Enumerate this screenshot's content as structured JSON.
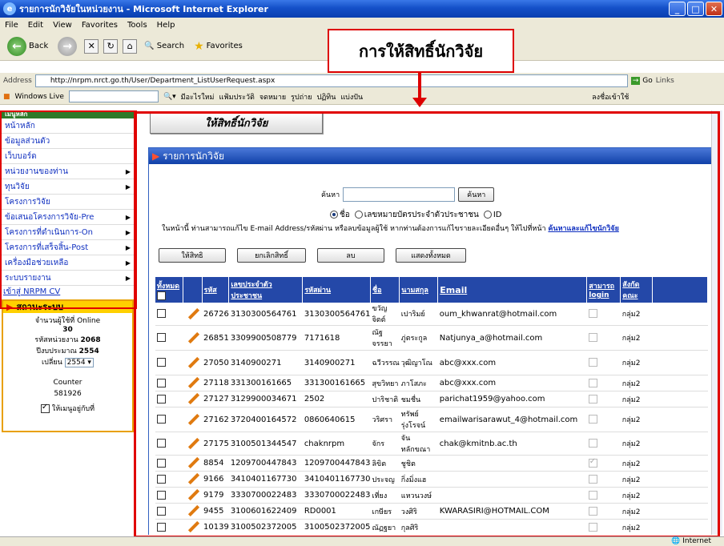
{
  "window": {
    "title": "รายการนักวิจัยในหน่วยงาน - Microsoft Internet Explorer",
    "icon": "ie-icon"
  },
  "menubar": [
    "File",
    "Edit",
    "View",
    "Favorites",
    "Tools",
    "Help"
  ],
  "toolbar": {
    "back": "Back",
    "search": "Search",
    "favorites": "Favorites"
  },
  "address": {
    "label": "Address",
    "url": "http://nrpm.nrct.go.th/User/Department_ListUserRequest.aspx",
    "go": "Go",
    "links": "Links"
  },
  "linkbar": {
    "windows_live": "Windows Live",
    "items": [
      "มีอะไรใหม่",
      "แฟ้มประวัติ",
      "จดหมาย",
      "รูปถ่าย",
      "ปฏิทิน",
      "แบ่งปัน"
    ],
    "signin": "ลงชื่อเข้าใช้"
  },
  "callout": "การให้สิทธิ์นักวิจัย",
  "sidebar": {
    "header": "เมนูหลัก",
    "items": [
      {
        "label": "หน้าหลัก",
        "arrow": false
      },
      {
        "label": "ข้อมูลส่วนตัว",
        "arrow": false
      },
      {
        "label": "เว็บบอร์ด",
        "arrow": false
      },
      {
        "label": "หน่วยงานของท่าน",
        "arrow": true
      },
      {
        "label": "ทุนวิจัย",
        "arrow": true
      },
      {
        "label": "โครงการวิจัย",
        "arrow": false
      },
      {
        "label": "ข้อเสนอโครงการวิจัย-Pre",
        "arrow": true
      },
      {
        "label": "โครงการที่ดำเนินการ-On",
        "arrow": true
      },
      {
        "label": "โครงการที่เสร็จสิ้น-Post",
        "arrow": true
      },
      {
        "label": "เครื่องมือช่วยเหลือ",
        "arrow": true
      },
      {
        "label": "ระบบรายงาน",
        "arrow": true
      }
    ],
    "cv_link": "เข้าสู่ NRPM CV",
    "status": {
      "header": "สถานะระบบ",
      "online_label": "จำนวนผู้ใช้ที่ Online",
      "online_count": "30",
      "unit_code_label": "รหัสหน่วยงาน",
      "unit_code": "2068",
      "budget_year_label": "ปีงบประมาณ",
      "budget_year": "2554",
      "change_label": "เปลี่ยน",
      "change_value": "2554",
      "counter_label": "Counter",
      "counter_value": "581926",
      "pin_label": "ให้เมนูอยู่กับที่"
    }
  },
  "main": {
    "grant_button": "ให้สิทธิ์นักวิจัย",
    "panel_title": "รายการนักวิจัย",
    "search_label": "ค้นหา",
    "search_button": "ค้นหา",
    "radio_options": [
      "ชื่อ",
      "เลขหมายบัตรประจำตัวประชาชน",
      "ID"
    ],
    "note": "ในหน้านี้ ท่านสามารถแก้ไข E-mail Address/รหัสผ่าน หรือลบข้อมูลผู้ใช้ หากท่านต้องการแก้ไขรายละเอียดอื่นๆ ให้ไปที่หน้า",
    "note_link": "ค้นหาและแก้ไขนักวิจัย",
    "actions": [
      "ให้สิทธิ",
      "ยกเลิกสิทธิ์",
      "ลบ",
      "แสดงทั้งหมด"
    ],
    "columns": {
      "all": "ทั้งหมด",
      "id": "รหัส",
      "citizen_id": "เลขประจำตัวประชาชน",
      "password": "รหัสผ่าน",
      "first": "ชื่อ",
      "last": "นามสกุล",
      "email": "Email",
      "can_login": "สามารถ login",
      "affil": "สังกัดคณะ"
    },
    "rows": [
      {
        "id": "26726",
        "citizen": "3130300564761",
        "password": "3130300564761",
        "first": "ขวัญจิตต์",
        "last": "เปาริมย์",
        "email": "oum_khwanrat@hotmail.com",
        "login": false,
        "group": "กลุ่ม2",
        "tall": false
      },
      {
        "id": "26851",
        "citizen": "3309900508779",
        "password": "7171618",
        "first": "ณัฐจรรยา",
        "last": "ภู่ตระกูล",
        "email": "Natjunya_a@hotmail.com",
        "login": false,
        "group": "กลุ่ม2",
        "tall": true
      },
      {
        "id": "27050",
        "citizen": "3140900271",
        "password": "3140900271",
        "first": "ฉวีวรรณ",
        "last": "วุฒิญาโณ",
        "email": "abc@xxx.com",
        "login": false,
        "group": "กลุ่ม2",
        "tall": true
      },
      {
        "id": "27118",
        "citizen": "331300161665",
        "password": "331300161665",
        "first": "สุขวิทยา",
        "last": "ภาโสภะ",
        "email": "abc@xxx.com",
        "login": false,
        "group": "กลุ่ม2",
        "tall": false
      },
      {
        "id": "27127",
        "citizen": "3129900034671",
        "password": "2502",
        "first": "ปาริชาติ",
        "last": "ชมชื่น",
        "email": "parichat1959@yahoo.com",
        "login": false,
        "group": "กลุ่ม2",
        "tall": false
      },
      {
        "id": "27162",
        "citizen": "3720400164572",
        "password": "0860640615",
        "first": "วริศรา",
        "last": "ทรัพย์รุ่งโรจน์",
        "email": "emailwarisarawut_4@hotmail.com",
        "login": false,
        "group": "กลุ่ม2",
        "tall": true
      },
      {
        "id": "27175",
        "citizen": "3100501344547",
        "password": "chaknrpm",
        "first": "จักร",
        "last": "จันทลักขณา",
        "email": "chak@kmitnb.ac.th",
        "login": false,
        "group": "กลุ่ม2",
        "tall": false
      },
      {
        "id": "8854",
        "citizen": "1209700447843",
        "password": "1209700447843",
        "first": "ลิขิต",
        "last": "ชูชิต",
        "email": "",
        "login": true,
        "group": "กลุ่ม2",
        "tall": false
      },
      {
        "id": "9166",
        "citizen": "3410401167730",
        "password": "3410401167730",
        "first": "ประจญ",
        "last": "กิ่งมิ่งแฮ",
        "email": "",
        "login": false,
        "group": "กลุ่ม2",
        "tall": false
      },
      {
        "id": "9179",
        "citizen": "3330700022483",
        "password": "3330700022483",
        "first": "เที่ยง",
        "last": "แหวนวงษ์",
        "email": "",
        "login": false,
        "group": "กลุ่ม2",
        "tall": false
      },
      {
        "id": "9455",
        "citizen": "3100601622409",
        "password": "RD0001",
        "first": "เกษียร",
        "last": "วงศิริ",
        "email": "KWARASIRI@HOTMAIL.COM",
        "login": false,
        "group": "กลุ่ม2",
        "tall": false
      },
      {
        "id": "10139",
        "citizen": "3100502372005",
        "password": "3100502372005",
        "first": "ณัฏฐยา",
        "last": "กุลศิริ",
        "email": "",
        "login": false,
        "group": "กลุ่ม2",
        "tall": false
      }
    ]
  },
  "statusbar": {
    "zone": "Internet"
  }
}
